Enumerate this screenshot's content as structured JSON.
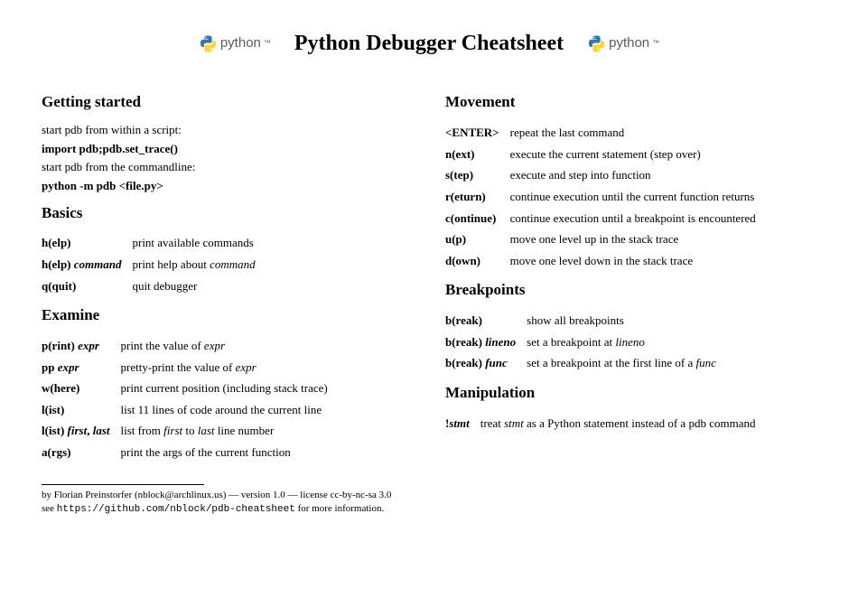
{
  "title": "Python Debugger Cheatsheet",
  "logo_text": "python",
  "left": {
    "getting_started": {
      "heading": "Getting started",
      "l1": "start pdb from within a script:",
      "l2": "import pdb;pdb.set_trace()",
      "l3": "start pdb from the commandline:",
      "l4": "python -m pdb <file.py>"
    },
    "basics": {
      "heading": "Basics",
      "rows": [
        {
          "cmd": "<b>h(elp)</b>",
          "desc": "print available commands"
        },
        {
          "cmd": "<b>h(elp)</b> <b><i>command</i></b>",
          "desc": "print help about <i>command</i>"
        },
        {
          "cmd": "<b>q(quit)</b>",
          "desc": "quit debugger"
        }
      ]
    },
    "examine": {
      "heading": "Examine",
      "rows": [
        {
          "cmd": "<b>p(rint)</b> <b><i>expr</i></b>",
          "desc": "print the value of <i>expr</i>"
        },
        {
          "cmd": "<b>pp</b> <b><i>expr</i></b>",
          "desc": "pretty-print the value of <i>expr</i>"
        },
        {
          "cmd": "<b>w(here)</b>",
          "desc": "print current position (including stack trace)"
        },
        {
          "cmd": "<b>l(ist)</b>",
          "desc": "list 11 lines of code around the current line"
        },
        {
          "cmd": "<b>l(ist)</b> <b><i>first</i></b><b>,</b> <b><i>last</i></b>",
          "desc": "list from <i>first</i> to <i>last</i> line number"
        },
        {
          "cmd": "<b>a(rgs)</b>",
          "desc": "print the args of the current function"
        }
      ]
    }
  },
  "right": {
    "movement": {
      "heading": "Movement",
      "rows": [
        {
          "cmd": "<b>&lt;ENTER&gt;</b>",
          "desc": "repeat the last command"
        },
        {
          "cmd": "<b>n(ext)</b>",
          "desc": "execute the current statement (step over)"
        },
        {
          "cmd": "<b>s(tep)</b>",
          "desc": "execute and step into function"
        },
        {
          "cmd": "<b>r(eturn)</b>",
          "desc": "continue execution until the current function returns"
        },
        {
          "cmd": "<b>c(ontinue)</b>",
          "desc": "continue execution until a breakpoint is encountered"
        },
        {
          "cmd": "<b>u(p)</b>",
          "desc": "move one level up in the stack trace"
        },
        {
          "cmd": "<b>d(own)</b>",
          "desc": "move one level down in the stack trace"
        }
      ]
    },
    "breakpoints": {
      "heading": "Breakpoints",
      "rows": [
        {
          "cmd": "<b>b(reak)</b>",
          "desc": "show all breakpoints"
        },
        {
          "cmd": "<b>b(reak)</b> <b><i>lineno</i></b>",
          "desc": "set a breakpoint at <i>lineno</i>"
        },
        {
          "cmd": "<b>b(reak)</b> <b><i>func</i></b>",
          "desc": "set a breakpoint at the first line of a <i>func</i>"
        }
      ]
    },
    "manipulation": {
      "heading": "Manipulation",
      "rows": [
        {
          "cmd": "<b>!<i>stmt</i></b>",
          "desc": "treat <i>stmt</i> as a Python statement instead of a pdb command"
        }
      ]
    }
  },
  "footer": {
    "l1": "by Florian Preinstorfer (nblock@archlinux.us) — version 1.0 — license cc-by-nc-sa 3.0",
    "l2a": "see ",
    "l2b": "https://github.com/nblock/pdb-cheatsheet",
    "l2c": " for more information."
  }
}
